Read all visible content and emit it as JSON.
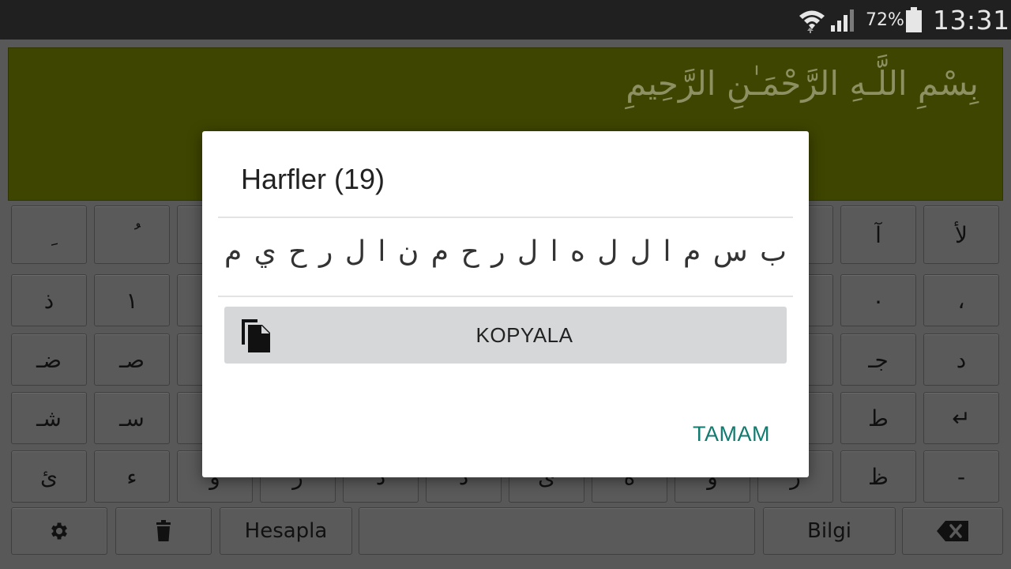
{
  "status_bar": {
    "battery_percent": "72%",
    "time": "13:31",
    "icons": [
      "wifi-icon",
      "signal-icon",
      "battery-icon"
    ]
  },
  "text_area": {
    "value": "بِسْمِ اللَّـهِ الرَّحْمَـٰنِ الرَّحِيمِ"
  },
  "keyboard": {
    "rows": [
      [
        "ِ",
        "ُ",
        "",
        "",
        "",
        "",
        "",
        "",
        "",
        "",
        "آ",
        "لأ"
      ],
      [
        "ذ",
        "١",
        "",
        "",
        "",
        "",
        "",
        "",
        "",
        "",
        "٠",
        "،"
      ],
      [
        "ضـ",
        "صـ",
        "",
        "",
        "",
        "",
        "",
        "",
        "",
        "",
        "جـ",
        "د"
      ],
      [
        "شـ",
        "سـ",
        "",
        "",
        "",
        "",
        "",
        "",
        "",
        "",
        "ط",
        "↵"
      ],
      [
        "ئ",
        "ء",
        "و",
        "ر",
        "د",
        "ذ",
        "ى",
        "ه",
        "و",
        "ز",
        "ظ",
        "-"
      ]
    ],
    "bottom": {
      "calculate_label": "Hesapla",
      "info_label": "Bilgi"
    },
    "icons": [
      "gear-icon",
      "trash-icon",
      "backspace-icon"
    ]
  },
  "dialog": {
    "title": "Harfler (19)",
    "letters": "ب س م ا ل ل ه ا ل ر ح م ن ا ل ر ح ي م",
    "copy_label": "KOPYALA",
    "ok_label": "TAMAM",
    "colors": {
      "accent": "#117b6f",
      "button_bg": "#d6d7d9"
    }
  }
}
